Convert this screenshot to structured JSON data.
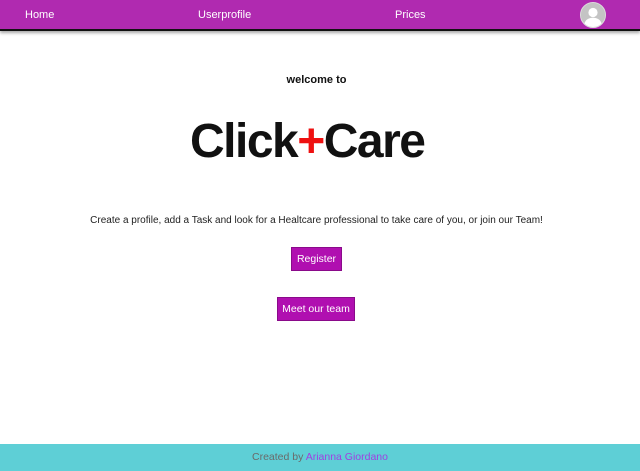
{
  "nav": {
    "home": "Home",
    "userprofile": "Userprofile",
    "prices": "Prices",
    "avatar_icon": "user-avatar-icon"
  },
  "hero": {
    "welcome": "welcome to",
    "logo_part1": "Click",
    "logo_plus": "+",
    "logo_part2": "Care",
    "description": "Create a profile, add a Task and look for a Healtcare professional to take care of you, or join our Team!"
  },
  "actions": {
    "register": "Register",
    "meet_team": "Meet our team"
  },
  "footer": {
    "created_by": "Created by ",
    "author": "Arianna Giordano"
  },
  "colors": {
    "navbar": "#b02ab0",
    "button": "#b00fb0",
    "logo_plus": "#ee1111",
    "footer": "#5ecfd6",
    "footer_link": "#a040e0"
  }
}
